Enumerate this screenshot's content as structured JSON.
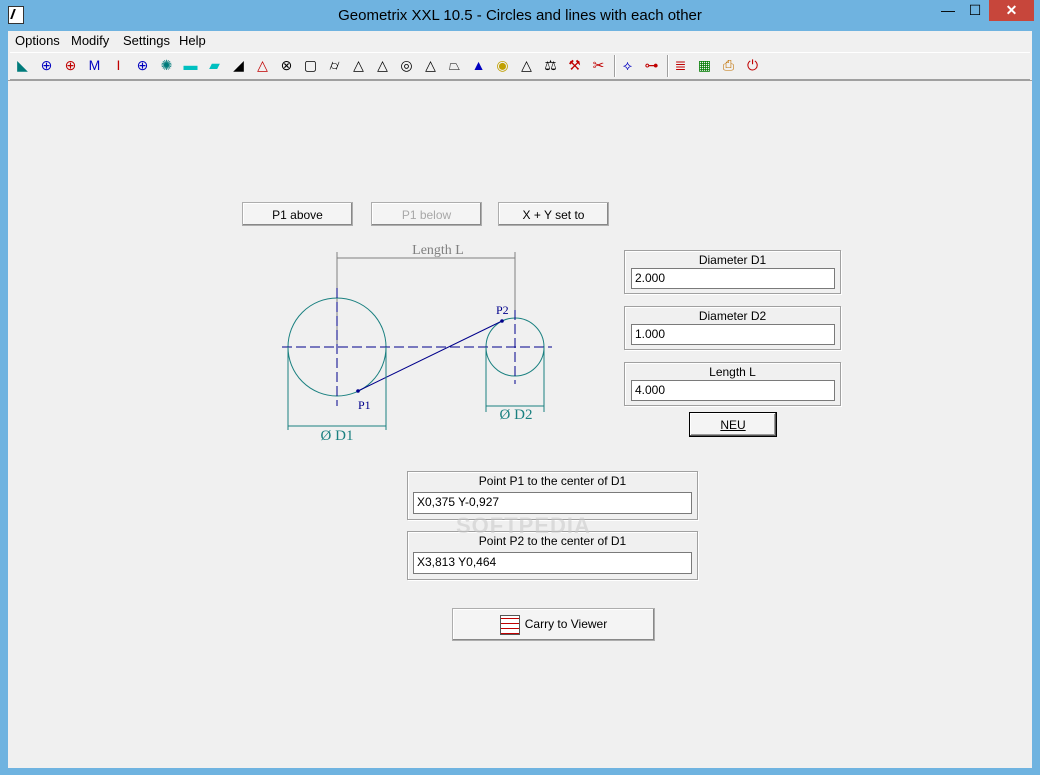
{
  "window": {
    "title": "Geometrix XXL 10.5 - Circles and lines with each other",
    "min": "—",
    "max": "☐",
    "close": "✕"
  },
  "menu": [
    "Options",
    "Modify",
    "Settings",
    "Help"
  ],
  "toolbar_icons": [
    {
      "name": "curve-tool-icon",
      "glyph": "◣",
      "color": "#007b7b"
    },
    {
      "name": "circle-crosshair-icon",
      "glyph": "⊕",
      "color": "#0000c0"
    },
    {
      "name": "circle-bold-crosshair-icon",
      "glyph": "⊕",
      "color": "#c00000"
    },
    {
      "name": "m-profile-icon",
      "glyph": "M",
      "color": "#0000c0"
    },
    {
      "name": "i-beam-icon",
      "glyph": "I",
      "color": "#c00000"
    },
    {
      "name": "flange-circle-icon",
      "glyph": "⊕",
      "color": "#0000c0"
    },
    {
      "name": "bolt-circle-icon",
      "glyph": "✺",
      "color": "#007b7b"
    },
    {
      "name": "rectangle-icon",
      "glyph": "▬",
      "color": "#00c0c0"
    },
    {
      "name": "parallelogram-icon",
      "glyph": "▰",
      "color": "#00c0c0"
    },
    {
      "name": "right-triangle-icon",
      "glyph": "◢",
      "color": "#000000"
    },
    {
      "name": "triangle-icon",
      "glyph": "△",
      "color": "#c00000"
    },
    {
      "name": "cone-section-icon",
      "glyph": "⊗",
      "color": "#000000"
    },
    {
      "name": "box-icon",
      "glyph": "▢",
      "color": "#000000"
    },
    {
      "name": "cylinder-icon",
      "glyph": "⌭",
      "color": "#000000"
    },
    {
      "name": "pyramid-icon",
      "glyph": "△",
      "color": "#000000"
    },
    {
      "name": "pyramid-2-icon",
      "glyph": "△",
      "color": "#000000"
    },
    {
      "name": "sphere-icon",
      "glyph": "◎",
      "color": "#000000"
    },
    {
      "name": "cone-icon",
      "glyph": "△",
      "color": "#000000"
    },
    {
      "name": "frustum-icon",
      "glyph": "⏢",
      "color": "#000000"
    },
    {
      "name": "trapezoid-solid-icon",
      "glyph": "▲",
      "color": "#0000c0"
    },
    {
      "name": "ellipse-icon",
      "glyph": "◉",
      "color": "#c0a000"
    },
    {
      "name": "pyramid-3-icon",
      "glyph": "△",
      "color": "#000000"
    },
    {
      "name": "weight-icon",
      "glyph": "⚖",
      "color": "#000000"
    },
    {
      "name": "cad-export-icon",
      "glyph": "⚒",
      "color": "#c00000"
    },
    {
      "name": "tools-icon",
      "glyph": "✂",
      "color": "#c00000"
    },
    {
      "name": "circles-lines-icon",
      "glyph": "⟡",
      "color": "#0000c0"
    },
    {
      "name": "tangent-icon",
      "glyph": "⊶",
      "color": "#c00000"
    },
    {
      "name": "viewer-list-icon",
      "glyph": "≣",
      "color": "#c00000"
    },
    {
      "name": "calculator-icon",
      "glyph": "▦",
      "color": "#007b00"
    },
    {
      "name": "print-icon",
      "glyph": "⎙",
      "color": "#c07000"
    },
    {
      "name": "exit-icon",
      "glyph": "⏻",
      "color": "#c00000"
    }
  ],
  "buttons": {
    "p1_above": "P1 above",
    "p1_below": "P1 below",
    "xy_set": "X + Y set to",
    "neu": "NEU",
    "carry": "Carry to Viewer"
  },
  "fields": {
    "d1": {
      "label": "Diameter D1",
      "value": "2.000"
    },
    "d2": {
      "label": "Diameter D2",
      "value": "1.000"
    },
    "length": {
      "label": "Length L",
      "value": "4.000"
    },
    "p1": {
      "label": "Point P1 to the center of D1",
      "value": "X0,375 Y-0,927"
    },
    "p2": {
      "label": "Point P2 to the center of D1",
      "value": "X3,813 Y0,464"
    }
  },
  "drawing": {
    "length_label": "Length L",
    "d1_label": "Ø  D1",
    "d2_label": "Ø  D2",
    "p1_label": "P1",
    "p2_label": "P2"
  },
  "watermark": "SOFTPEDIA",
  "colors": {
    "circle": "#1a8080",
    "centerline": "#00008b",
    "line": "#00008b",
    "dimension": "#808080"
  }
}
